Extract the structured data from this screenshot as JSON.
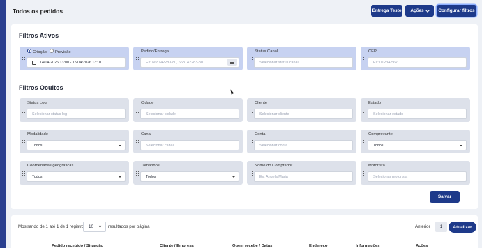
{
  "header": {
    "title": "Todos os pedidos",
    "btn_entrega_teste": "Entrega Teste",
    "btn_acoes": "Ações",
    "btn_configurar": "Configurar filtros"
  },
  "active_filters": {
    "title": "Filtros Ativos",
    "date": {
      "option_criacao": "Criação",
      "option_previsao": "Previsão",
      "selected": "Criação",
      "range": "14/04/2026 13:00 - 15/04/2026 13:01"
    },
    "pedido": {
      "label": "Pedido/Entrega",
      "placeholder": "Ex: 668142283-80, 668142283-80"
    },
    "status_canal": {
      "label": "Status Canal",
      "placeholder": "Selecionar status canal"
    },
    "cep": {
      "label": "CEP",
      "placeholder": "Ex: 01234-567"
    }
  },
  "hidden_filters": {
    "title": "Filtros Ocultos",
    "status_log": {
      "label": "Status Log",
      "placeholder": "Selecionar status log"
    },
    "cidade": {
      "label": "Cidade",
      "placeholder": "Selecionar cidade"
    },
    "cliente": {
      "label": "Cliente",
      "placeholder": "Selecionar cliente"
    },
    "estado": {
      "label": "Estado",
      "placeholder": "Selecionar estado"
    },
    "modalidade": {
      "label": "Modalidade",
      "value": "Todos"
    },
    "canal": {
      "label": "Canal",
      "placeholder": "Selecionar canal"
    },
    "conta": {
      "label": "Conta",
      "placeholder": "Selecionar conta"
    },
    "comprovante": {
      "label": "Comprovante",
      "value": "Todos"
    },
    "coordenadas": {
      "label": "Coordenadas geográficas",
      "value": "Todos"
    },
    "tamanhos": {
      "label": "Tamanhos",
      "value": "Todos"
    },
    "comprador": {
      "label": "Nome do Comprador",
      "placeholder": "Ex: Angela Maria"
    },
    "motorista": {
      "label": "Motorista",
      "placeholder": "Selecionar motorista"
    }
  },
  "save_label": "Salvar",
  "pagination": {
    "showing": "Mostrando de 1 até 1 de 1 registros",
    "per_page_value": "10",
    "per_page_suffix": "resultados por página",
    "prev": "Anterior",
    "page": "1",
    "update": "Atualizar"
  },
  "table": {
    "headers": [
      "Pedido recebido / Situação",
      "Cliente / Empresa",
      "Quem recebe / Datas",
      "Endereço",
      "Informações",
      "Ações"
    ]
  },
  "colors": {
    "primary": "#1e3a8a",
    "active_card": "#c7d2f1",
    "card": "#dde1ea"
  }
}
